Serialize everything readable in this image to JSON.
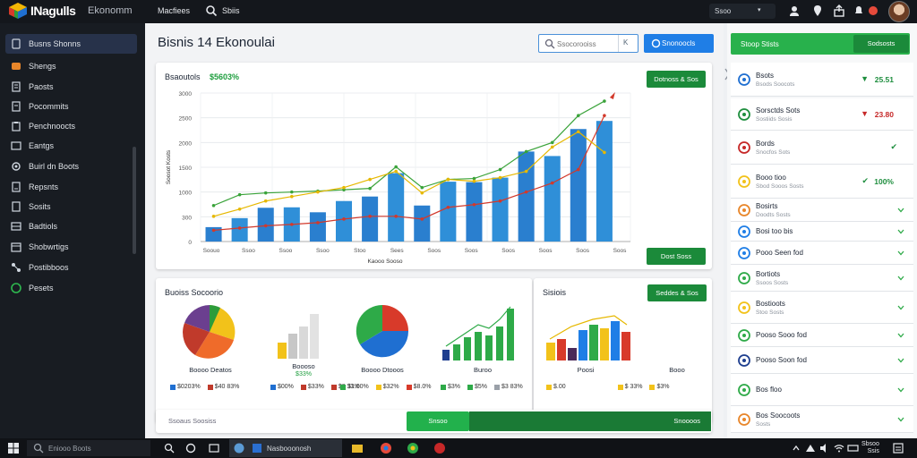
{
  "topbar": {
    "brand": "INagulls",
    "subtitle": "Ekonomm",
    "nav_first": "Macfiees",
    "nav_second": "Sbiis",
    "user_menu": "Ssoo"
  },
  "sidebar": {
    "items": [
      {
        "label": "Busns Shonns"
      },
      {
        "label": "Shengs"
      },
      {
        "label": "Paosts"
      },
      {
        "label": "Pocommits"
      },
      {
        "label": "Penchnoocts"
      },
      {
        "label": "Eantgs"
      },
      {
        "label": "Buirl dn Boots"
      },
      {
        "label": "Repsnts"
      },
      {
        "label": "Sosits"
      },
      {
        "label": "Badtiols"
      },
      {
        "label": "Shobwrtigs"
      },
      {
        "label": "Postibboos"
      },
      {
        "label": "Pesets"
      }
    ]
  },
  "main": {
    "title": "Bisnis 14 Ekonoulai",
    "search_placeholder": "Ssocorooiss",
    "search_shortcut": "K",
    "primary_button": "Snonoocls",
    "card1": {
      "title": "Bsaoutols",
      "title_value": "$5603%",
      "button_top": "Dotnoss & Sos",
      "button_bottom": "Dost Soss"
    },
    "card2": {
      "title": "Buoiss Socoorio",
      "minis": [
        {
          "label": "Boooo Deatos",
          "legend": [
            "$0203%",
            "$40 83%"
          ]
        },
        {
          "label": "Boooso",
          "sub": "$33%",
          "legend": [
            "$00%",
            "$33%",
            "$8 33%"
          ]
        },
        {
          "label": "Boooo Dtooos",
          "legend": [
            "$1.00%",
            "$32%",
            "$8.0%"
          ]
        },
        {
          "label": "Buroo",
          "legend": [
            "$3%",
            "$5%",
            "$3 83%"
          ]
        }
      ]
    },
    "card3": {
      "title": "Sisiois",
      "button": "Seddes & Sos",
      "labels": [
        "Poosi",
        "Booo"
      ],
      "legend": [
        "$.00",
        "$ 33%",
        "$3%"
      ]
    },
    "card4": {
      "label": "Ssoaus Soosiss",
      "seg1": "Snsoo",
      "seg2": "Snoooos"
    }
  },
  "chart_data": {
    "type": "bar",
    "title": "Bsaoutols",
    "ylabel": "Soosot Kosts",
    "xlabel": "Kaooo Sooso",
    "y_ticks": [
      "0",
      "300",
      "1000",
      "1500",
      "2000",
      "2500",
      "3000"
    ],
    "x_ticks": [
      "Soouo",
      "Ssoo",
      "Ssoo",
      "Ssoo",
      "Stoo",
      "Sees",
      "Soos",
      "Soos",
      "Soos",
      "Soos",
      "Soos",
      "Soos"
    ],
    "ylim": [
      0,
      3300
    ],
    "series": [
      {
        "values": [
          320,
          520,
          750,
          760,
          650,
          900,
          1000,
          1520,
          800,
          1330,
          1320,
          1420,
          2000,
          1900,
          2500,
          2680
        ]
      },
      {
        "values": [
          800,
          1040,
          1080,
          1100,
          1120,
          1150,
          1180,
          1660,
          1200,
          1380,
          1400,
          1600,
          2000,
          2200,
          2800,
          3120
        ]
      },
      {
        "values": [
          250,
          300,
          350,
          380,
          420,
          500,
          560,
          560,
          500,
          760,
          820,
          900,
          1100,
          1300,
          1600,
          2800
        ]
      },
      {
        "values": [
          560,
          720,
          900,
          1000,
          1100,
          1200,
          1380,
          1560,
          1080,
          1380,
          1340,
          1420,
          1560,
          2100,
          2440,
          1980
        ]
      }
    ]
  },
  "rpanel": {
    "header": "Stoop Stists",
    "header_button": "Sodsosts",
    "items": [
      {
        "t1": "Bsots",
        "t2": "Bsods Soocots",
        "value": "25.51",
        "arrow": "▼",
        "color": "#1e8e3e"
      },
      {
        "t1": "Sorsctds Sots",
        "t2": "Sostiids Sosis",
        "value": "23.80",
        "arrow": "▼",
        "color": "#c62828"
      },
      {
        "t1": "Bords",
        "t2": "Snocfos Sots",
        "value": "",
        "arrow": "✔",
        "color": "#1e8e3e"
      },
      {
        "t1": "Booo tioo",
        "t2": "Sbod Sooos Sosts",
        "value": "100%",
        "arrow": "✔",
        "color": "#1e8e3e"
      },
      {
        "t1": "Bosirts",
        "t2": "Doodts Sosts"
      },
      {
        "t1": "Bosi too bis"
      },
      {
        "t1": "Pooo Seen fod"
      },
      {
        "t1": "Bortiots",
        "t2": "Ssoos Sosts"
      },
      {
        "t1": "Bostioots",
        "t2": "Stoo Sosts"
      },
      {
        "t1": "Pooso Sooo fod"
      },
      {
        "t1": "Pooso Soon fod"
      },
      {
        "t1": "Bos floo"
      },
      {
        "t1": "Bos Soocoots",
        "t2": "Sosts"
      }
    ]
  },
  "taskbar": {
    "search": "Eniooo Boots",
    "app_name": "Nasbooonosh",
    "time": "Sbsoo",
    "date": "Ssis"
  },
  "colors": {
    "accent_blue": "#1f7ee6",
    "accent_green": "#1b8a3a",
    "bar_blue": "#2f8fd8",
    "line_green": "#3aa33a",
    "line_red": "#d2392b",
    "line_yellow": "#e6b800"
  }
}
